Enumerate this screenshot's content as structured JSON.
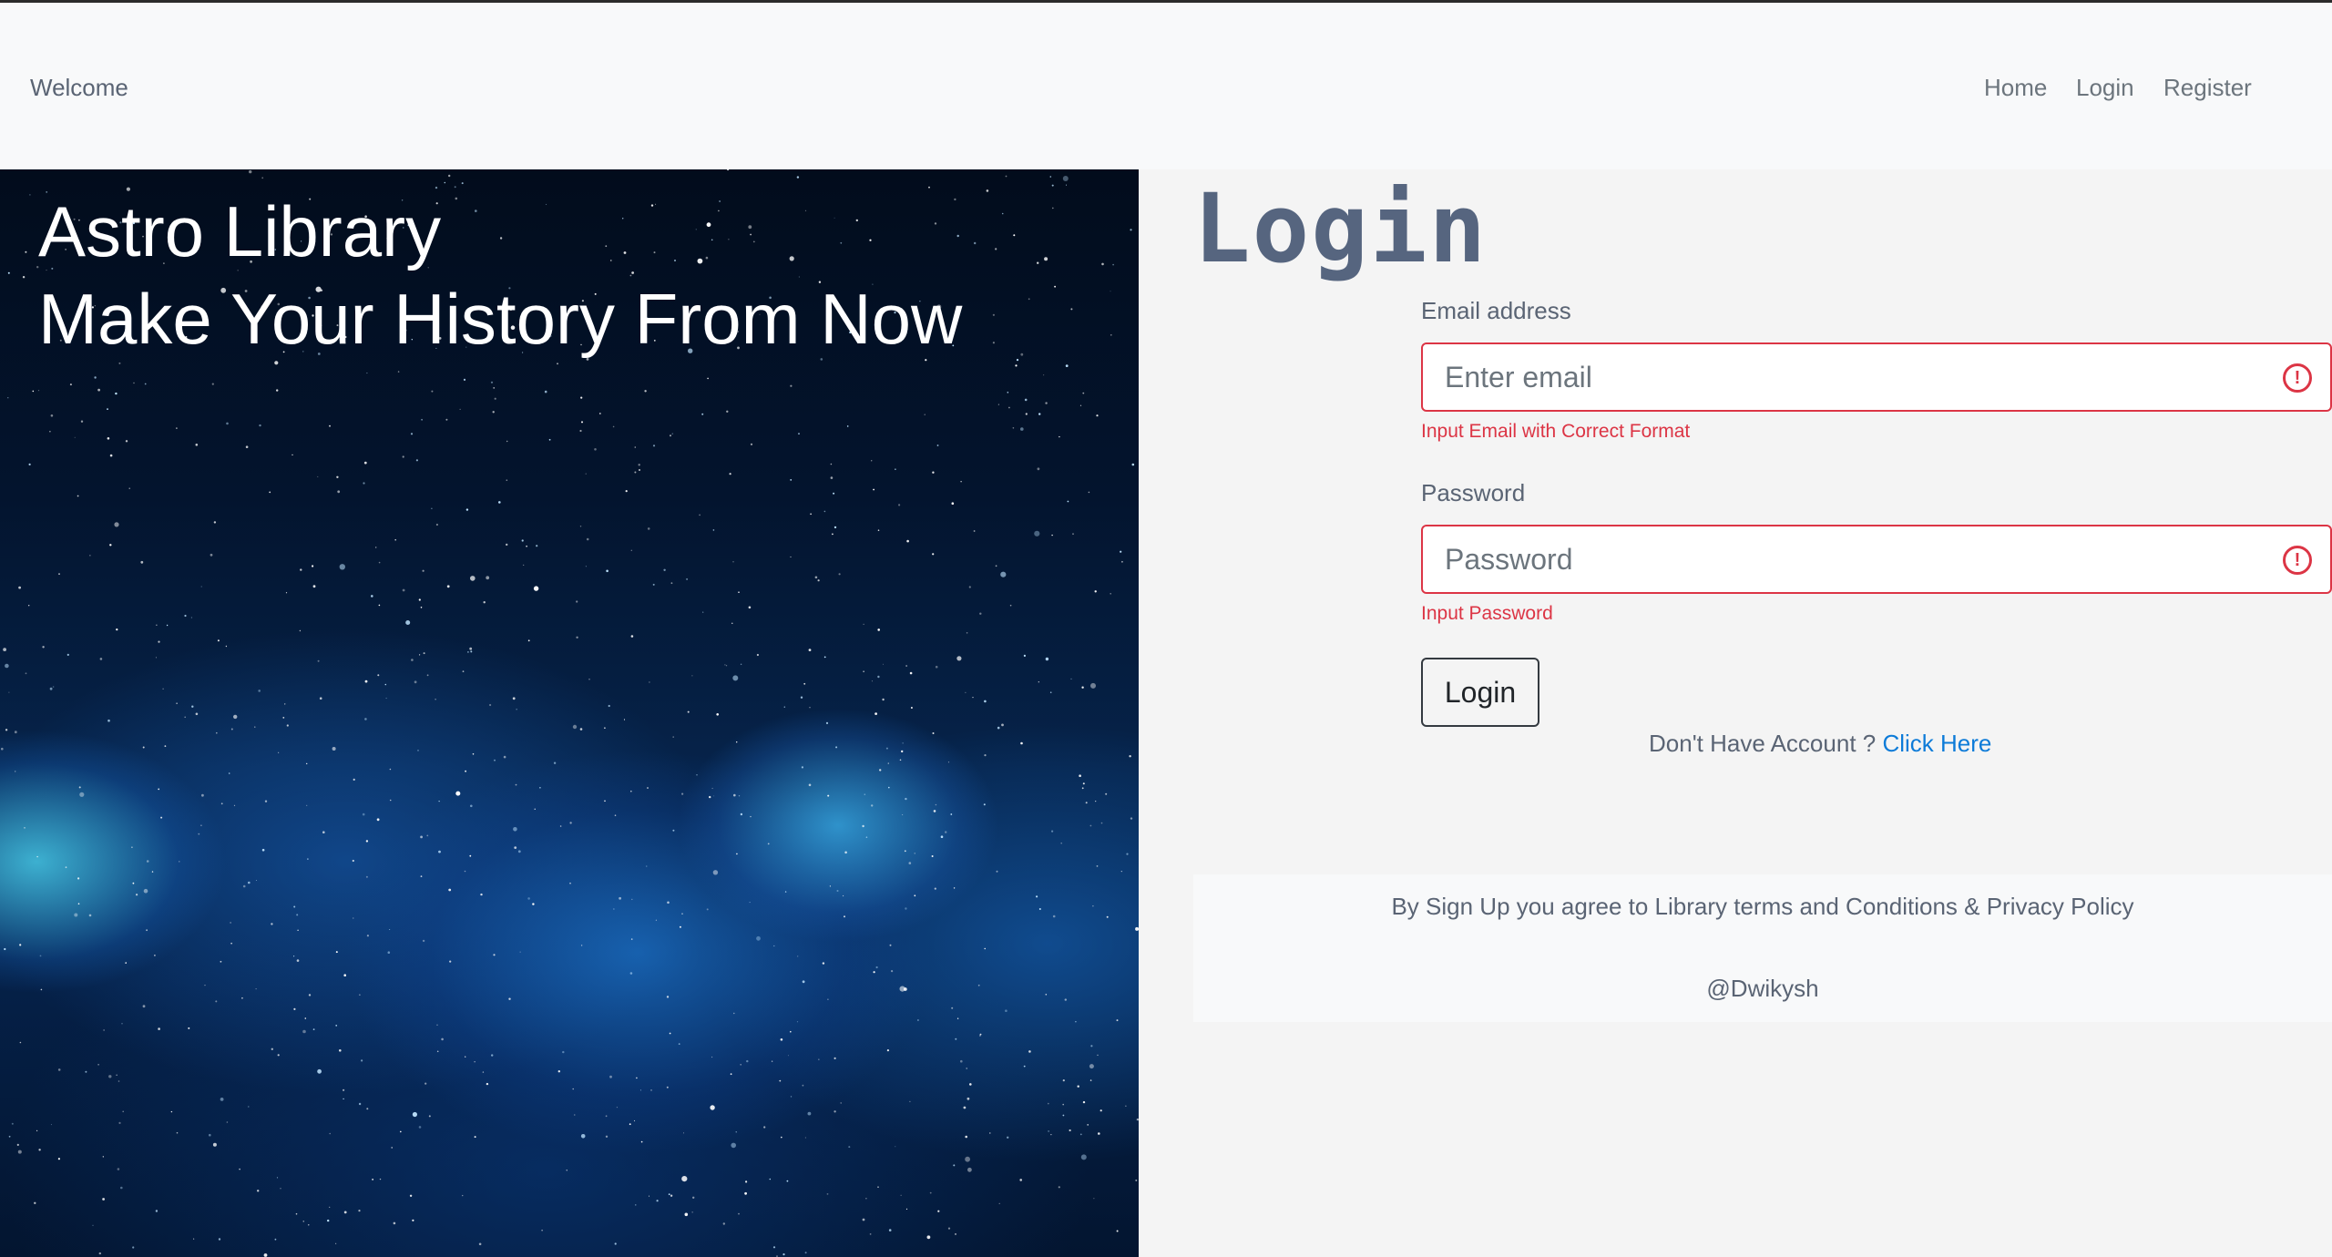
{
  "navbar": {
    "brand": "Welcome",
    "links": [
      "Home",
      "Login",
      "Register"
    ]
  },
  "hero": {
    "line1": "Astro Library",
    "line2": "Make Your History From Now"
  },
  "login": {
    "heading": "Login",
    "email_label": "Email address",
    "email_placeholder": "Enter email",
    "email_error": "Input Email with Correct Format",
    "password_label": "Password",
    "password_placeholder": "Password",
    "password_error": "Input Password",
    "button_label": "Login",
    "no_account_text": "Don't Have Account ?",
    "click_here": "Click Here"
  },
  "footer": {
    "terms": "By Sign Up you agree to Library terms and Conditions & Privacy Policy",
    "handle": "@Dwikysh"
  },
  "colors": {
    "error": "#dc3545",
    "link": "#0d7bd8",
    "heading": "#56657f"
  }
}
